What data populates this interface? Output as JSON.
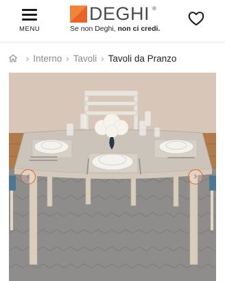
{
  "header": {
    "menu_label": "MENU",
    "brand_name": "DEGHI",
    "brand_registered": "®",
    "tagline_prefix": "Se non Deghi,",
    "tagline_bold": "non ci credi.",
    "brand_color": "#e8632a",
    "icons": {
      "menu": "hamburger-icon",
      "wishlist": "heart-icon"
    }
  },
  "breadcrumb": {
    "home_icon": "home-icon",
    "items": [
      {
        "label": "Interno"
      },
      {
        "label": "Tavoli"
      }
    ],
    "current": "Tavoli da Pranzo",
    "separator": "›"
  },
  "gallery": {
    "image_subject": "product-photo",
    "prev_icon": "chevron-left-icon",
    "next_icon": "chevron-right-icon",
    "prev_glyph": "‹",
    "next_glyph": "›",
    "accent_color": "#ea5b22"
  }
}
